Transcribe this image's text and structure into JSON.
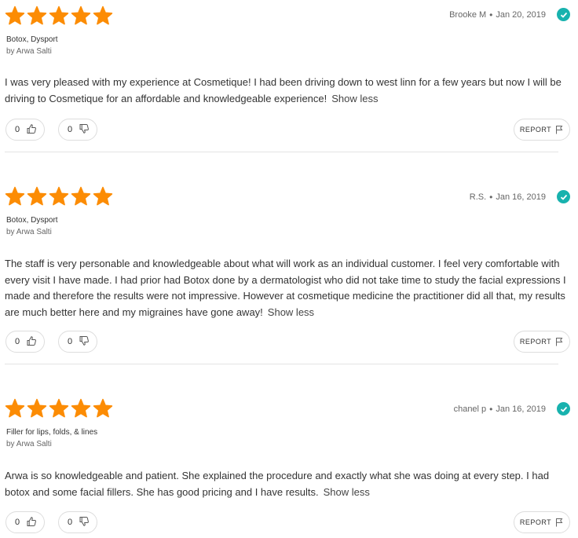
{
  "reviews": [
    {
      "reviewer": "Brooke M",
      "date": "Jan 20, 2019",
      "treatments": "Botox, Dysport",
      "author": "by Arwa Salti",
      "text": "I was very pleased with my experience at Cosmetique! I had been driving down to west linn for a few years but now I will be driving to Cosmetique for an affordable and knowledgeable experience!",
      "show_less": "Show less",
      "helpful_count": "0",
      "unhelpful_count": "0",
      "report_label": "REPORT",
      "rating": 5
    },
    {
      "reviewer": "R.S.",
      "date": "Jan 16, 2019",
      "treatments": "Botox, Dysport",
      "author": "by Arwa Salti",
      "text": "The staff is very personable and knowledgeable about what will work as an individual customer. I feel very comfortable with every visit I have made. I had prior had Botox done by a dermatologist who did not take time to study the facial expressions I made and therefore the results were not impressive. However at cosmetique medicine the practitioner did all that, my results are much better here and my migraines have gone away!",
      "show_less": "Show less",
      "helpful_count": "0",
      "unhelpful_count": "0",
      "report_label": "REPORT",
      "rating": 5
    },
    {
      "reviewer": "chanel p",
      "date": "Jan 16, 2019",
      "treatments": "Filler for lips, folds, & lines",
      "author": "by Arwa Salti",
      "text": "Arwa is so knowledgeable and patient. She explained the procedure and exactly what she was doing at every step. I had botox and some facial fillers. She has good pricing and I have results.",
      "show_less": "Show less",
      "helpful_count": "0",
      "unhelpful_count": "0",
      "report_label": "REPORT",
      "rating": 5
    }
  ],
  "colors": {
    "star": "#fc8c04",
    "verified": "#18b2ae"
  },
  "icons": {
    "star": "star-icon",
    "verified": "verified-check-icon",
    "up": "thumbs-up-icon",
    "down": "thumbs-down-icon",
    "flag": "flag-icon"
  }
}
